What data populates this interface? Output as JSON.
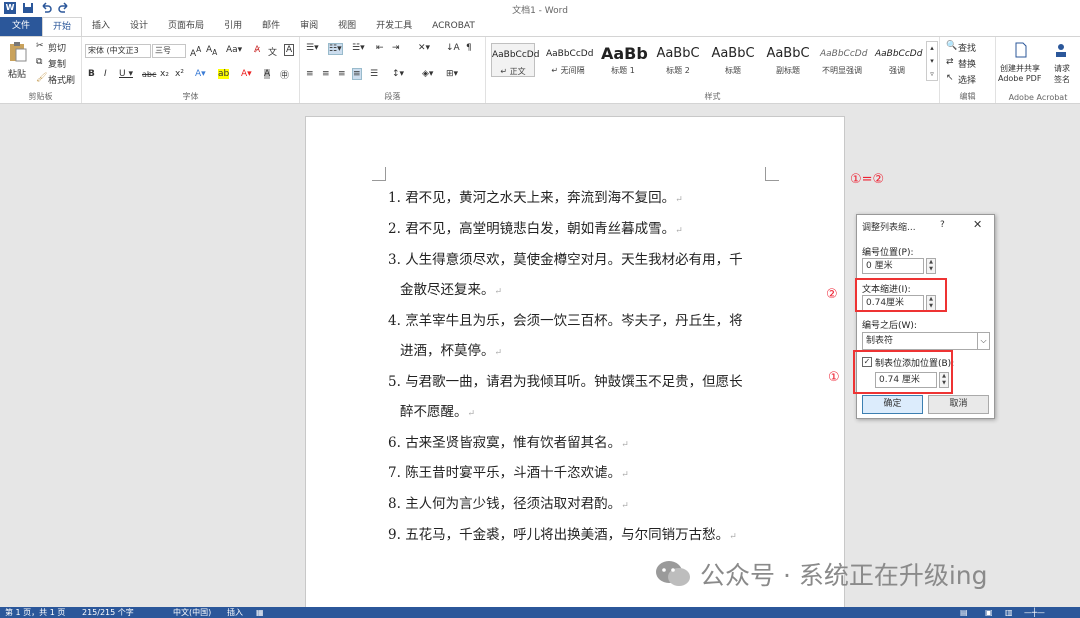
{
  "window": {
    "title": "文档1 - Word"
  },
  "tabs": [
    "文件",
    "开始",
    "插入",
    "设计",
    "页面布局",
    "引用",
    "邮件",
    "审阅",
    "视图",
    "开发工具",
    "ACROBAT"
  ],
  "ribbon": {
    "clipboard": {
      "paste": "粘贴",
      "cut": "剪切",
      "copy": "复制",
      "format_painter": "格式刷",
      "label": "剪贴板"
    },
    "font": {
      "font_name": "宋体 (中文正3",
      "font_size": "三号",
      "label": "字体"
    },
    "paragraph": {
      "label": "段落"
    },
    "styles": {
      "label": "样式",
      "items": [
        {
          "sample": "AaBbCcDd",
          "name": "↵ 正文"
        },
        {
          "sample": "AaBbCcDd",
          "name": "↵ 无间隔"
        },
        {
          "sample": "AaBb",
          "name": "标题 1"
        },
        {
          "sample": "AaBbC",
          "name": "标题 2"
        },
        {
          "sample": "AaBbC",
          "name": "标题"
        },
        {
          "sample": "AaBbC",
          "name": "副标题"
        },
        {
          "sample": "AaBbCcDd",
          "name": "不明显强调"
        },
        {
          "sample": "AaBbCcDd",
          "name": "强调"
        }
      ]
    },
    "editing": {
      "find": "查找",
      "replace": "替换",
      "select": "选择",
      "label": "编辑"
    },
    "acrobat": {
      "create": "创建并共享",
      "create2": "Adobe PDF",
      "request": "请求",
      "request2": "签名",
      "label": "Adobe Acrobat"
    }
  },
  "document": {
    "items": [
      {
        "num": "1.",
        "line1": "君不见，黄河之水天上来，奔流到海不复回。",
        "line2": ""
      },
      {
        "num": "2.",
        "line1": "君不见，高堂明镜悲白发，朝如青丝暮成雪。",
        "line2": ""
      },
      {
        "num": "3.",
        "line1": "人生得意须尽欢，莫使金樽空对月。天生我材必有用，千",
        "line2": "金散尽还复来。"
      },
      {
        "num": "4.",
        "line1": "烹羊宰牛且为乐，会须一饮三百杯。岑夫子，丹丘生，将",
        "line2": "进酒，杯莫停。"
      },
      {
        "num": "5.",
        "line1": "与君歌一曲，请君为我倾耳听。钟鼓馔玉不足贵，但愿长",
        "line2": "醉不愿醒。"
      },
      {
        "num": "6.",
        "line1": "古来圣贤皆寂寞，惟有饮者留其名。",
        "line2": ""
      },
      {
        "num": "7.",
        "line1": "陈王昔时宴平乐，斗酒十千恣欢谑。",
        "line2": ""
      },
      {
        "num": "8.",
        "line1": "主人何为言少钱，径须沽取对君酌。",
        "line2": ""
      },
      {
        "num": "9.",
        "line1": "五花马，千金裘，呼儿将出换美酒，与尔同销万古愁。",
        "line2": ""
      }
    ],
    "para_mark": "↵"
  },
  "annotations": {
    "eq": "①=②",
    "c1": "①",
    "c2": "②"
  },
  "dialog": {
    "title": "调整列表缩...",
    "help": "?",
    "close": "✕",
    "number_position_label": "编号位置(P):",
    "number_position_value": "0 厘米",
    "text_indent_label": "文本缩进(I):",
    "text_indent_value": "0.74厘米",
    "follow_number_label": "编号之后(W):",
    "follow_number_value": "制表符",
    "add_tab_label": "制表位添加位置(B):",
    "add_tab_checked": "✓",
    "tab_value": "0.74 厘米",
    "ok": "确定",
    "cancel": "取消"
  },
  "status": {
    "page": "第 1 页，共 1 页",
    "words": "215/215 个字",
    "lang": "中文(中国)",
    "mode": "插入"
  },
  "watermark": "公众号 · 系统正在升级ing",
  "colors": {
    "accent": "#2b579a",
    "red": "#e33333"
  }
}
